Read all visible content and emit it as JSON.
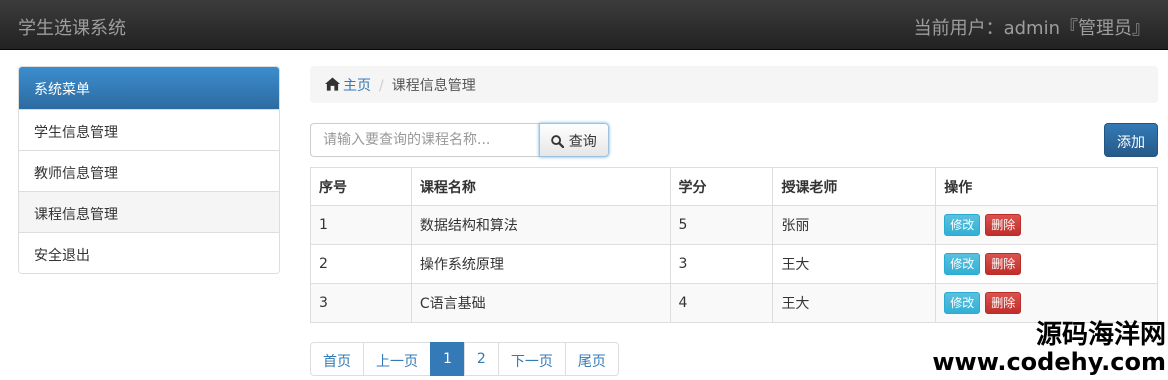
{
  "navbar": {
    "brand": "学生选课系统",
    "user": "当前用户：admin『管理员』"
  },
  "sidebar": {
    "title": "系统菜单",
    "items": [
      {
        "label": "学生信息管理"
      },
      {
        "label": "教师信息管理"
      },
      {
        "label": "课程信息管理"
      },
      {
        "label": "安全退出"
      }
    ],
    "active_index": 2
  },
  "breadcrumb": {
    "home": "主页",
    "current": "课程信息管理"
  },
  "search": {
    "placeholder": "请输入要查询的课程名称...",
    "button": "查询"
  },
  "add_button": "添加",
  "table": {
    "headers": [
      "序号",
      "课程名称",
      "学分",
      "授课老师",
      "操作"
    ],
    "rows": [
      {
        "id": "1",
        "name": "数据结构和算法",
        "credit": "5",
        "teacher": "张丽"
      },
      {
        "id": "2",
        "name": "操作系统原理",
        "credit": "3",
        "teacher": "王大"
      },
      {
        "id": "3",
        "name": "C语言基础",
        "credit": "4",
        "teacher": "王大"
      }
    ],
    "edit_label": "修改",
    "delete_label": "删除"
  },
  "pagination": {
    "first": "首页",
    "prev": "上一页",
    "pages": [
      "1",
      "2"
    ],
    "current": "1",
    "next": "下一页",
    "last": "尾页"
  },
  "watermark": {
    "line1": "源码海洋网",
    "line2": "www.codehy.com"
  },
  "colors": {
    "primary": "#337ab7",
    "info": "#5bc0de",
    "danger": "#d9534f",
    "navbar": "#222222"
  }
}
